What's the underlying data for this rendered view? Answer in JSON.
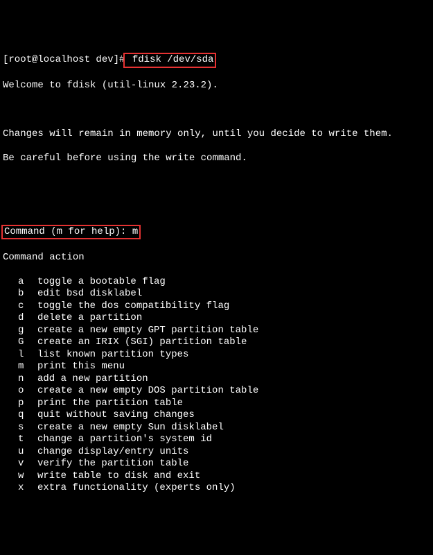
{
  "prompt1": {
    "prefix": "[root@localhost dev]#",
    "command": " fdisk /dev/sda"
  },
  "welcome": "Welcome to fdisk (util-linux 2.23.2).",
  "blank": "",
  "notice1": "Changes will remain in memory only, until you decide to write them.",
  "notice2": "Be careful before using the write command.",
  "prompt2": {
    "prefix": "Command (m for help): ",
    "input": "m"
  },
  "action_header": "Command action",
  "actions": [
    {
      "key": "a",
      "desc": "toggle a bootable flag"
    },
    {
      "key": "b",
      "desc": "edit bsd disklabel"
    },
    {
      "key": "c",
      "desc": "toggle the dos compatibility flag"
    },
    {
      "key": "d",
      "desc": "delete a partition"
    },
    {
      "key": "g",
      "desc": "create a new empty GPT partition table"
    },
    {
      "key": "G",
      "desc": "create an IRIX (SGI) partition table"
    },
    {
      "key": "l",
      "desc": "list known partition types"
    },
    {
      "key": "m",
      "desc": "print this menu"
    },
    {
      "key": "n",
      "desc": "add a new partition"
    },
    {
      "key": "o",
      "desc": "create a new empty DOS partition table"
    },
    {
      "key": "p",
      "desc": "print the partition table"
    },
    {
      "key": "q",
      "desc": "quit without saving changes"
    },
    {
      "key": "s",
      "desc": "create a new empty Sun disklabel"
    },
    {
      "key": "t",
      "desc": "change a partition's system id"
    },
    {
      "key": "u",
      "desc": "change display/entry units"
    },
    {
      "key": "v",
      "desc": "verify the partition table"
    },
    {
      "key": "w",
      "desc": "write table to disk and exit"
    },
    {
      "key": "x",
      "desc": "extra functionality (experts only)"
    }
  ]
}
